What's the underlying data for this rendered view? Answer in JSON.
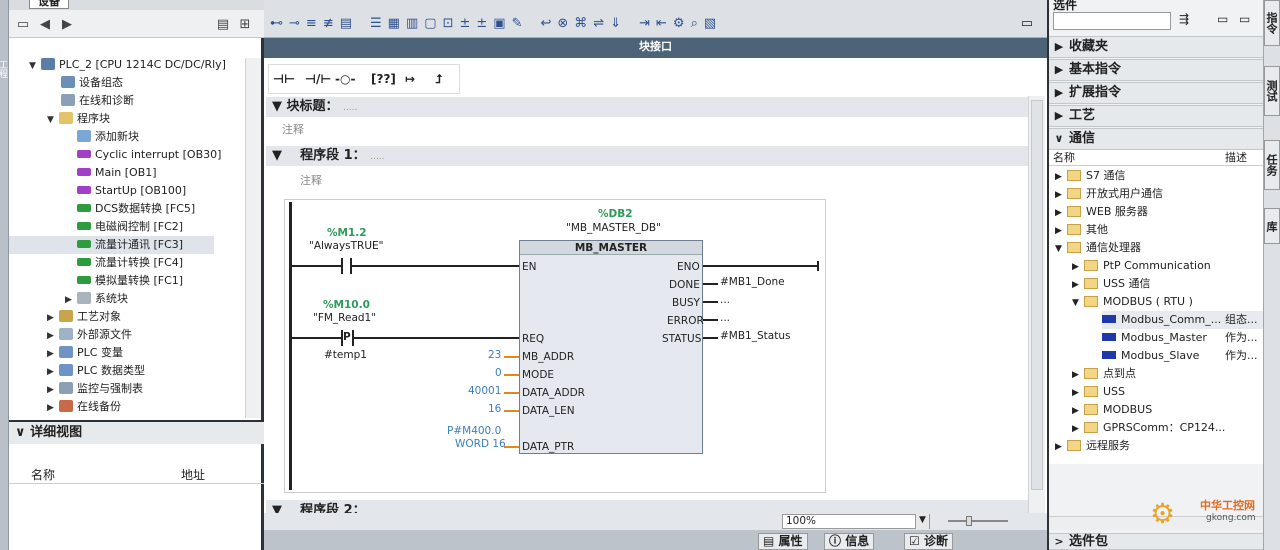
{
  "left_strip": {
    "label": "工程"
  },
  "tree": {
    "tab": "设备",
    "items": [
      {
        "label": "PLC_2 [CPU 1214C DC/DC/Rly]"
      },
      {
        "label": "设备组态"
      },
      {
        "label": "在线和诊断"
      },
      {
        "label": "程序块"
      },
      {
        "label": "添加新块"
      },
      {
        "label": "Cyclic interrupt [OB30]"
      },
      {
        "label": "Main [OB1]"
      },
      {
        "label": "StartUp [OB100]"
      },
      {
        "label": "DCS数据转换 [FC5]"
      },
      {
        "label": "电磁阀控制 [FC2]"
      },
      {
        "label": "流量计通讯 [FC3]"
      },
      {
        "label": "流量计转换 [FC4]"
      },
      {
        "label": "模拟量转换 [FC1]"
      },
      {
        "label": "系统块"
      },
      {
        "label": "工艺对象"
      },
      {
        "label": "外部源文件"
      },
      {
        "label": "PLC 变量"
      },
      {
        "label": "PLC 数据类型"
      },
      {
        "label": "监控与强制表"
      },
      {
        "label": "在线备份"
      }
    ]
  },
  "detail": {
    "title": "详细视图",
    "col_name": "名称",
    "col_addr": "地址"
  },
  "editor": {
    "interface_bar": "块接口",
    "block_title": "块标题：",
    "block_title_val": ".....",
    "comment": "注释",
    "network1": "程序段 1：",
    "network1_val": ".....",
    "network1_comment": "注释",
    "network2": "程序段 2：",
    "ladder_icons": [
      "⊣⊢",
      "⊣/⊢",
      "-○-",
      "[??]",
      "↦",
      "⮥"
    ]
  },
  "network": {
    "db_addr": "%DB2",
    "db_name": "\"MB_MASTER_DB\"",
    "block_type": "MB_MASTER",
    "c1_addr": "%M1.2",
    "c1_name": "\"AlwaysTRUE\"",
    "c2_addr": "%M10.0",
    "c2_name": "\"FM_Read1\"",
    "c2_sym": "P",
    "c2_temp": "#temp1",
    "pins_in": [
      "EN",
      "REQ",
      "MB_ADDR",
      "MODE",
      "DATA_ADDR",
      "DATA_LEN",
      "DATA_PTR"
    ],
    "pins_out": [
      "ENO",
      "DONE",
      "BUSY",
      "ERROR",
      "STATUS"
    ],
    "val_mb_addr": "23",
    "val_mode": "0",
    "val_data_addr": "40001",
    "val_data_len": "16",
    "val_ptr1": "P#M400.0",
    "val_ptr2": "WORD 16",
    "out_done": "#MB1_Done",
    "out_busy": "...",
    "out_error": "...",
    "out_status": "#MB1_Status"
  },
  "zoom": {
    "value": "100%"
  },
  "bottom_tabs": {
    "props": "属性",
    "info": "信息",
    "diag": "诊断"
  },
  "right": {
    "title": "选件",
    "palettes": [
      "收藏夹",
      "基本指令",
      "扩展指令",
      "工艺",
      "通信"
    ],
    "col_name": "名称",
    "col_desc": "描述",
    "items": [
      {
        "label": "S7 通信",
        "desc": ""
      },
      {
        "label": "开放式用户通信",
        "desc": ""
      },
      {
        "label": "WEB 服务器",
        "desc": ""
      },
      {
        "label": "其他",
        "desc": ""
      },
      {
        "label": "通信处理器",
        "desc": ""
      },
      {
        "label": "PtP Communication",
        "desc": ""
      },
      {
        "label": "USS 通信",
        "desc": ""
      },
      {
        "label": "MODBUS ( RTU )",
        "desc": ""
      },
      {
        "label": "Modbus_Comm_...",
        "desc": "组态..."
      },
      {
        "label": "Modbus_Master",
        "desc": "作为..."
      },
      {
        "label": "Modbus_Slave",
        "desc": "作为..."
      },
      {
        "label": "点到点",
        "desc": ""
      },
      {
        "label": "USS",
        "desc": ""
      },
      {
        "label": "MODBUS",
        "desc": ""
      },
      {
        "label": "GPRSComm：CP124...",
        "desc": ""
      },
      {
        "label": "远程服务",
        "desc": ""
      }
    ],
    "bottom": "选件包"
  },
  "right_strip": {
    "tabs": [
      "指令",
      "测试",
      "任务",
      "库"
    ]
  },
  "watermark": {
    "line1": "中华工控网",
    "line2": "gkong.com"
  },
  "colors": {
    "green_label": "#2f9b5a",
    "blue_value": "#3c7fc0",
    "interface_bar": "#4d6478",
    "block_bg": "#e5e8ee"
  }
}
